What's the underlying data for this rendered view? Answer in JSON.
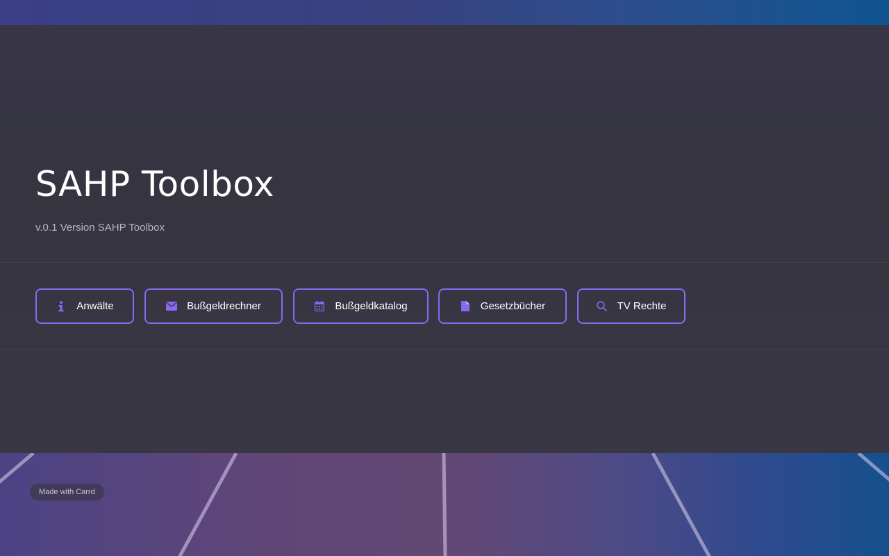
{
  "page": {
    "title": "SAHP Toolbox",
    "subtitle": "v.0.1 Version SAHP Toolbox"
  },
  "buttons": [
    {
      "label": "Anwälte",
      "icon": "info-icon"
    },
    {
      "label": "Bußgeldrechner",
      "icon": "envelope-icon"
    },
    {
      "label": "Bußgeldkatalog",
      "icon": "calendar-icon"
    },
    {
      "label": "Gesetzbücher",
      "icon": "file-icon"
    },
    {
      "label": "TV Rechte",
      "icon": "search-icon"
    }
  ],
  "footer": {
    "badge": "Made with Carrd"
  },
  "colors": {
    "accent": "#8a68f0",
    "panel": "#36343f",
    "text": "#ffffff",
    "muted": "#b9b5c3"
  }
}
